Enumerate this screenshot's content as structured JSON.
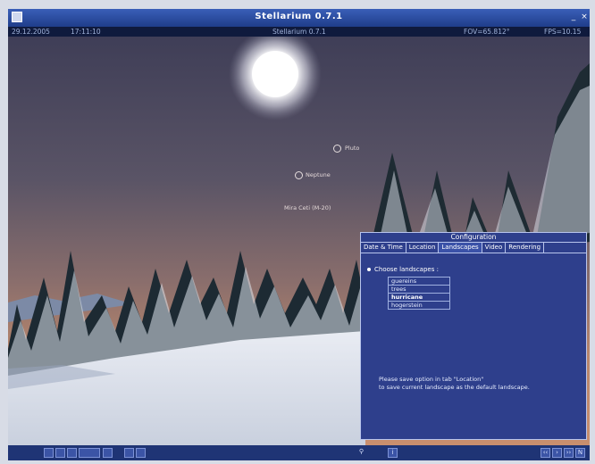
{
  "window": {
    "title": "Stellarium 0.7.1",
    "minimize_label": "_",
    "close_label": "×"
  },
  "status": {
    "date": "29.12.2005",
    "time": "17:11:10",
    "location": "Stellarium 0.7.1",
    "fov": "FOV=65.812°",
    "fps": "FPS=10.15"
  },
  "sky_labels": [
    {
      "name": "Pluto",
      "ring": true
    },
    {
      "name": "Neptune",
      "ring": true
    },
    {
      "name": "Mira Ceti (M-20)",
      "ring": false
    }
  ],
  "config": {
    "title": "Configuration",
    "tabs": [
      "Date & Time",
      "Location",
      "Landscapes",
      "Video",
      "Rendering"
    ],
    "active_tab": 2,
    "choose_label": "Choose landscapes :",
    "landscapes": [
      "guereins",
      "trees",
      "hurricane",
      "hogerstein"
    ],
    "selected_landscape": 2,
    "note_line1": "Please save option in tab \"Location\"",
    "note_line2": "to save current landscape as the default landscape."
  },
  "toolbar": {
    "left_buttons": [
      "constellation-lines",
      "constellation-names",
      "azimuthal-grid",
      "equatorial-grid",
      "ground",
      "cardinal-points",
      "atmosphere"
    ],
    "right_buttons": [
      "config",
      "help"
    ],
    "time_buttons": [
      "‹‹",
      "›",
      "››",
      "N"
    ]
  },
  "icons": {
    "search": "search-icon",
    "info": "info-icon"
  },
  "colors": {
    "title_bar": "#2a4ea8",
    "dialog_bg": "#2e3f8c",
    "toolbar": "#1f3475"
  }
}
